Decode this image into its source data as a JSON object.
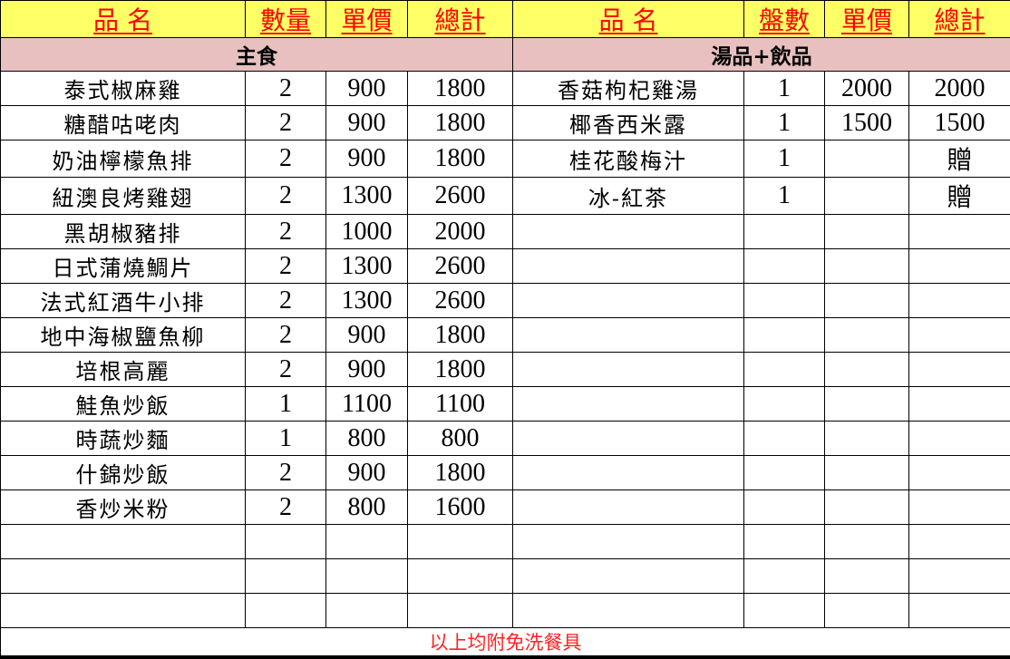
{
  "headers": {
    "left_name": "品 名",
    "left_qty": "數量",
    "left_price": "單價",
    "left_total": "總計",
    "right_name": "品 名",
    "right_qty": "盤數",
    "right_price": "單價",
    "right_total": "總計"
  },
  "sections": {
    "left": "主食",
    "right": "湯品+飲品"
  },
  "rows": [
    {
      "left": {
        "name": "泰式椒麻雞",
        "qty": "2",
        "price": "900",
        "total": "1800"
      },
      "right": {
        "name": "香菇枸杞雞湯",
        "qty": "1",
        "price": "2000",
        "total": "2000"
      }
    },
    {
      "left": {
        "name": "糖醋咕咾肉",
        "qty": "2",
        "price": "900",
        "total": "1800"
      },
      "right": {
        "name": "椰香西米露",
        "qty": "1",
        "price": "1500",
        "total": "1500"
      }
    },
    {
      "left": {
        "name": "奶油檸檬魚排",
        "qty": "2",
        "price": "900",
        "total": "1800"
      },
      "right": {
        "name": "桂花酸梅汁",
        "qty": "1",
        "price": "",
        "total": "贈"
      }
    },
    {
      "left": {
        "name": "紐澳良烤雞翅",
        "qty": "2",
        "price": "1300",
        "total": "2600"
      },
      "right": {
        "name": "冰-紅茶",
        "qty": "1",
        "price": "",
        "total": "贈"
      }
    },
    {
      "left": {
        "name": "黑胡椒豬排",
        "qty": "2",
        "price": "1000",
        "total": "2000"
      },
      "right": {
        "name": "",
        "qty": "",
        "price": "",
        "total": ""
      }
    },
    {
      "left": {
        "name": "日式蒲燒鯛片",
        "qty": "2",
        "price": "1300",
        "total": "2600"
      },
      "right": {
        "name": "",
        "qty": "",
        "price": "",
        "total": ""
      }
    },
    {
      "left": {
        "name": "法式紅酒牛小排",
        "qty": "2",
        "price": "1300",
        "total": "2600"
      },
      "right": {
        "name": "",
        "qty": "",
        "price": "",
        "total": ""
      }
    },
    {
      "left": {
        "name": "地中海椒鹽魚柳",
        "qty": "2",
        "price": "900",
        "total": "1800"
      },
      "right": {
        "name": "",
        "qty": "",
        "price": "",
        "total": ""
      }
    },
    {
      "left": {
        "name": "培根高麗",
        "qty": "2",
        "price": "900",
        "total": "1800"
      },
      "right": {
        "name": "",
        "qty": "",
        "price": "",
        "total": ""
      }
    },
    {
      "left": {
        "name": "鮭魚炒飯",
        "qty": "1",
        "price": "1100",
        "total": "1100"
      },
      "right": {
        "name": "",
        "qty": "",
        "price": "",
        "total": ""
      }
    },
    {
      "left": {
        "name": "時蔬炒麵",
        "qty": "1",
        "price": "800",
        "total": "800"
      },
      "right": {
        "name": "",
        "qty": "",
        "price": "",
        "total": ""
      }
    },
    {
      "left": {
        "name": "什錦炒飯",
        "qty": "2",
        "price": "900",
        "total": "1800"
      },
      "right": {
        "name": "",
        "qty": "",
        "price": "",
        "total": ""
      }
    },
    {
      "left": {
        "name": "香炒米粉",
        "qty": "2",
        "price": "800",
        "total": "1600"
      },
      "right": {
        "name": "",
        "qty": "",
        "price": "",
        "total": ""
      }
    },
    {
      "left": {
        "name": "",
        "qty": "",
        "price": "",
        "total": ""
      },
      "right": {
        "name": "",
        "qty": "",
        "price": "",
        "total": ""
      }
    },
    {
      "left": {
        "name": "",
        "qty": "",
        "price": "",
        "total": ""
      },
      "right": {
        "name": "",
        "qty": "",
        "price": "",
        "total": ""
      }
    },
    {
      "left": {
        "name": "",
        "qty": "",
        "price": "",
        "total": ""
      },
      "right": {
        "name": "",
        "qty": "",
        "price": "",
        "total": ""
      }
    }
  ],
  "footer": "以上均附免洗餐具",
  "colors": {
    "header_bg": "#ffff66",
    "header_text": "#ff0000",
    "section_bg": "#e8c0c0",
    "footer_text": "#ff2222"
  }
}
